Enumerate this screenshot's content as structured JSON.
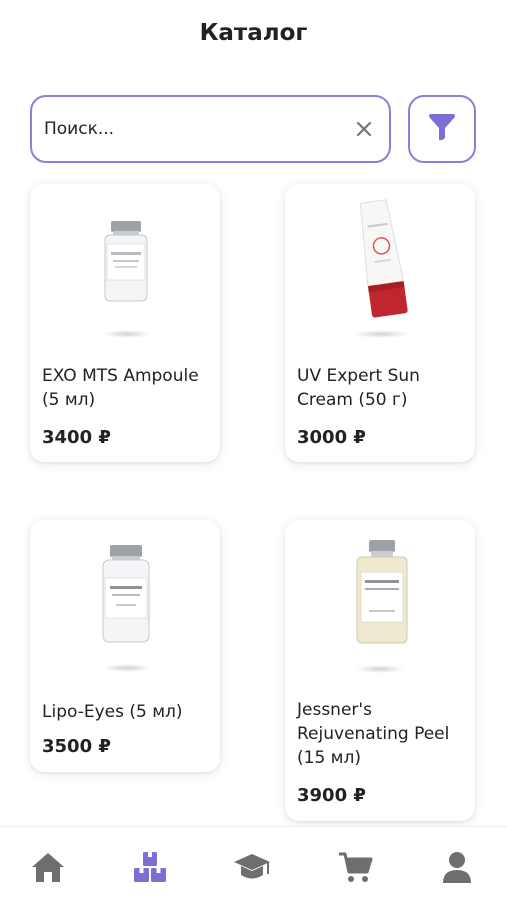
{
  "header": {
    "title": "Каталог"
  },
  "search": {
    "placeholder": "Поиск..."
  },
  "colors": {
    "accent": "#7b6fd6",
    "nav_inactive": "#6e6e6e",
    "text": "#222222"
  },
  "products": [
    {
      "name": "EXO MTS Ampoule (5 мл)",
      "price": "3400 ₽",
      "image": "vial-icon"
    },
    {
      "name": "UV Expert Sun Cream (50 г)",
      "price": "3000 ₽",
      "image": "sunscreen-tube-icon"
    },
    {
      "name": "Lipo-Eyes (5 мл)",
      "price": "3500 ₽",
      "image": "vial-icon"
    },
    {
      "name": "Jessner's Rejuvenating Peel (15 мл)",
      "price": "3900 ₽",
      "image": "bottle-icon"
    }
  ],
  "bottom_nav": [
    {
      "icon": "home-icon",
      "active": false
    },
    {
      "icon": "catalog-boxes-icon",
      "active": true
    },
    {
      "icon": "graduation-cap-icon",
      "active": false
    },
    {
      "icon": "cart-icon",
      "active": false
    },
    {
      "icon": "profile-icon",
      "active": false
    }
  ]
}
